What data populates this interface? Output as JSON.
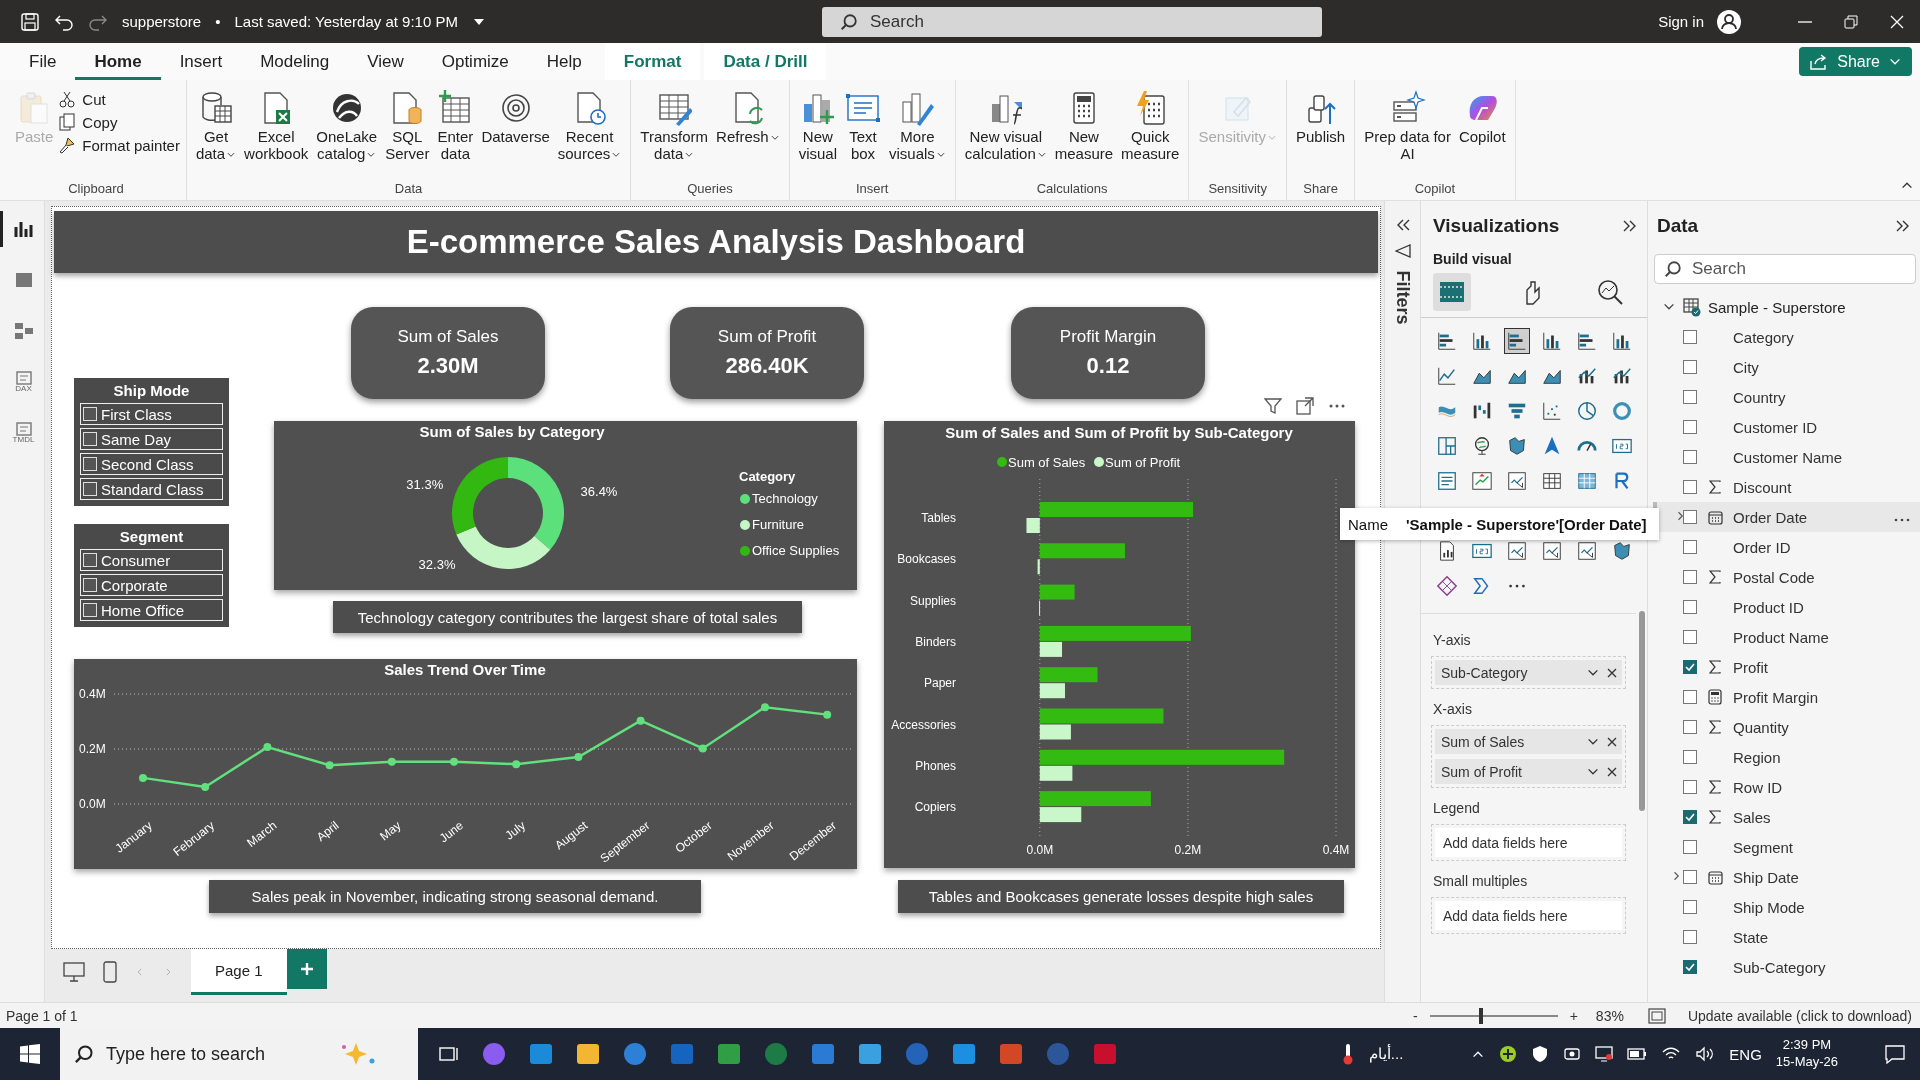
{
  "title_bar": {
    "file_name": "supperstore",
    "separator": "•",
    "saved": "Last saved: Yesterday at 9:10 PM",
    "search_placeholder": "Search",
    "sign_in": "Sign in"
  },
  "menu_tabs": [
    {
      "label": "File",
      "kind": "normal",
      "selected": false
    },
    {
      "label": "Home",
      "kind": "normal",
      "selected": true
    },
    {
      "label": "Insert",
      "kind": "normal",
      "selected": false
    },
    {
      "label": "Modeling",
      "kind": "normal",
      "selected": false
    },
    {
      "label": "View",
      "kind": "normal",
      "selected": false
    },
    {
      "label": "Optimize",
      "kind": "normal",
      "selected": false
    },
    {
      "label": "Help",
      "kind": "normal",
      "selected": false
    },
    {
      "label": "Format",
      "kind": "contextual",
      "selected": false
    },
    {
      "label": "Data / Drill",
      "kind": "contextual",
      "selected": false
    }
  ],
  "share_button": "Share",
  "ribbon": [
    {
      "group": "Clipboard",
      "buttons": [
        {
          "label": "Paste",
          "kind": "large",
          "disabled": true,
          "dropdown": false
        },
        {
          "label": "Cut",
          "kind": "small",
          "disabled": false,
          "dropdown": false
        },
        {
          "label": "Copy",
          "kind": "small",
          "disabled": false,
          "dropdown": false
        },
        {
          "label": "Format painter",
          "kind": "small",
          "disabled": false,
          "dropdown": false
        }
      ]
    },
    {
      "group": "Data",
      "buttons": [
        {
          "label": "Get\ndata",
          "kind": "large",
          "disabled": false,
          "dropdown": true
        },
        {
          "label": "Excel\nworkbook",
          "kind": "large",
          "disabled": false,
          "dropdown": false
        },
        {
          "label": "OneLake\ncatalog",
          "kind": "large",
          "disabled": false,
          "dropdown": true
        },
        {
          "label": "SQL\nServer",
          "kind": "large",
          "disabled": false,
          "dropdown": false
        },
        {
          "label": "Enter\ndata",
          "kind": "large",
          "disabled": false,
          "dropdown": false
        },
        {
          "label": "Dataverse",
          "kind": "large",
          "disabled": false,
          "dropdown": false
        },
        {
          "label": "Recent\nsources",
          "kind": "large",
          "disabled": false,
          "dropdown": true
        }
      ]
    },
    {
      "group": "Queries",
      "buttons": [
        {
          "label": "Transform\ndata",
          "kind": "large",
          "disabled": false,
          "dropdown": true
        },
        {
          "label": "Refresh",
          "kind": "large",
          "disabled": false,
          "dropdown": true
        }
      ]
    },
    {
      "group": "Insert",
      "buttons": [
        {
          "label": "New\nvisual",
          "kind": "large",
          "disabled": false,
          "dropdown": false
        },
        {
          "label": "Text\nbox",
          "kind": "large",
          "disabled": false,
          "dropdown": false
        },
        {
          "label": "More\nvisuals",
          "kind": "large",
          "disabled": false,
          "dropdown": true
        }
      ]
    },
    {
      "group": "Calculations",
      "buttons": [
        {
          "label": "New visual\ncalculation",
          "kind": "large",
          "disabled": false,
          "dropdown": true
        },
        {
          "label": "New\nmeasure",
          "kind": "large",
          "disabled": false,
          "dropdown": false
        },
        {
          "label": "Quick\nmeasure",
          "kind": "large",
          "disabled": false,
          "dropdown": false
        }
      ]
    },
    {
      "group": "Sensitivity",
      "buttons": [
        {
          "label": "Sensitivity",
          "kind": "large",
          "disabled": true,
          "dropdown": true
        }
      ]
    },
    {
      "group": "Share",
      "buttons": [
        {
          "label": "Publish",
          "kind": "large",
          "disabled": false,
          "dropdown": false
        }
      ]
    },
    {
      "group": "Copilot",
      "buttons": [
        {
          "label": "Prep data for\nAI",
          "kind": "large",
          "disabled": false,
          "dropdown": false
        },
        {
          "label": "Copilot",
          "kind": "large",
          "disabled": false,
          "dropdown": false
        }
      ]
    }
  ],
  "rail": [
    {
      "kind": "report",
      "selected": true
    },
    {
      "kind": "table",
      "selected": false
    },
    {
      "kind": "model",
      "selected": false
    },
    {
      "kind": "dax",
      "text": "DAX",
      "selected": false
    },
    {
      "kind": "tmdl",
      "text": "TMDL",
      "selected": false
    }
  ],
  "canvas": {
    "banner": "E-commerce Sales Analysis Dashboard",
    "cards": [
      {
        "label": "Sum of Sales",
        "value": "2.30M"
      },
      {
        "label": "Sum of Profit",
        "value": "286.40K"
      },
      {
        "label": "Profit Margin",
        "value": "0.12"
      }
    ],
    "slicers": [
      {
        "title": "Ship Mode",
        "items": [
          {
            "label": "First Class",
            "checked": false
          },
          {
            "label": "Same Day",
            "checked": false
          },
          {
            "label": "Second Class",
            "checked": false
          },
          {
            "label": "Standard Class",
            "checked": false
          }
        ]
      },
      {
        "title": "Segment",
        "items": [
          {
            "label": "Consumer",
            "checked": false
          },
          {
            "label": "Corporate",
            "checked": false
          },
          {
            "label": "Home Office",
            "checked": false
          }
        ]
      }
    ],
    "donut": {
      "legend_title": "Category",
      "legend": [
        {
          "color": "#5ce07c"
        },
        {
          "color": "#c6f5c6"
        },
        {
          "color": "#33b812"
        }
      ],
      "chart_data": {
        "type": "donut",
        "title": "Sum of Sales by Category",
        "categories": [
          "Technology",
          "Furniture",
          "Office Supplies"
        ],
        "series": [
          {
            "values": [
              36.4,
              32.3,
              31.3
            ]
          }
        ],
        "value_labels": [
          "36.4%",
          "32.3%",
          "31.3%"
        ],
        "legend": "right"
      }
    },
    "bar_chart": {
      "chart_data": {
        "type": "bar",
        "orientation": "horizontal",
        "title": "Sum of Sales and Sum of Profit by Sub-Category",
        "categories": [
          "Tables",
          "Bookcases",
          "Supplies",
          "Binders",
          "Paper",
          "Accessories",
          "Phones",
          "Copiers"
        ],
        "series": [
          {
            "name": "Sum of Sales",
            "color": "#33bb11",
            "values": [
              0.207,
              0.115,
              0.047,
              0.204,
              0.078,
              0.167,
              0.33,
              0.15
            ]
          },
          {
            "name": "Sum of Profit",
            "color": "#c9f7c9",
            "values": [
              -0.018,
              -0.003,
              -0.001,
              0.03,
              0.034,
              0.042,
              0.044,
              0.056
            ]
          }
        ],
        "xlim": [
          -0.02,
          0.4
        ],
        "xticks": [
          {
            "value": 0,
            "label": "0.0M"
          },
          {
            "value": 0.2,
            "label": "0.2M"
          },
          {
            "value": 0.4,
            "label": "0.4M"
          }
        ],
        "legend": "top"
      }
    },
    "line_chart": {
      "chart_data": {
        "type": "line",
        "title": "Sales Trend Over Time",
        "categories": [
          "January",
          "February",
          "March",
          "April",
          "May",
          "June",
          "July",
          "August",
          "September",
          "October",
          "November",
          "December"
        ],
        "series": [
          {
            "color": "#62e07e",
            "marker": "circle",
            "values": [
              0.095,
              0.062,
              0.207,
              0.141,
              0.154,
              0.154,
              0.145,
              0.171,
              0.303,
              0.202,
              0.352,
              0.325
            ]
          }
        ],
        "ylim": [
          0,
          0.4
        ],
        "yticks": [
          {
            "value": 0,
            "label": "0.0M"
          },
          {
            "value": 0.2,
            "label": "0.2M"
          },
          {
            "value": 0.4,
            "label": "0.4M"
          }
        ]
      }
    },
    "captions": [
      "Technology category contributes the largest share of total sales",
      "Sales peak in November, indicating strong seasonal demand.",
      "Tables and Bookcases generate losses despite high sales"
    ]
  },
  "filters_label": "Filters",
  "visualizations": {
    "title": "Visualizations",
    "subtitle": "Build visual",
    "tabs": [
      {
        "selected": true
      },
      {
        "selected": false
      },
      {
        "selected": false
      }
    ],
    "visual_types": [
      {
        "kind": "bar",
        "selected": false
      },
      {
        "kind": "column",
        "selected": false
      },
      {
        "kind": "bar",
        "selected": true
      },
      {
        "kind": "column",
        "selected": false
      },
      {
        "kind": "bar",
        "selected": false
      },
      {
        "kind": "column",
        "selected": false
      },
      {
        "kind": "line",
        "selected": false
      },
      {
        "kind": "area",
        "selected": false
      },
      {
        "kind": "area",
        "selected": false
      },
      {
        "kind": "area",
        "selected": false
      },
      {
        "kind": "combo",
        "selected": false
      },
      {
        "kind": "combo",
        "selected": false
      },
      {
        "kind": "ribbon",
        "selected": false
      },
      {
        "kind": "waterfall",
        "selected": false
      },
      {
        "kind": "funnel",
        "selected": false
      },
      {
        "kind": "scatter",
        "selected": false
      },
      {
        "kind": "pie",
        "selected": false
      },
      {
        "kind": "donut",
        "selected": false
      },
      {
        "kind": "treemap",
        "selected": false
      },
      {
        "kind": "globe",
        "selected": false
      },
      {
        "kind": "map",
        "selected": false
      },
      {
        "kind": "arrow",
        "selected": false
      },
      {
        "kind": "gauge",
        "selected": false
      },
      {
        "kind": "card",
        "selected": false
      },
      {
        "kind": "list",
        "selected": false
      },
      {
        "kind": "kpi",
        "selected": false
      },
      {
        "kind": "slicer",
        "selected": false
      },
      {
        "kind": "table",
        "selected": false
      },
      {
        "kind": "matrix",
        "selected": false
      },
      {
        "kind": "script",
        "selected": false
      },
      {
        "kind": "report",
        "selected": false
      },
      {
        "kind": "card",
        "selected": false
      },
      {
        "kind": "slicer",
        "selected": false
      },
      {
        "kind": "slicer",
        "selected": false
      },
      {
        "kind": "slicer",
        "selected": false
      },
      {
        "kind": "map",
        "selected": false
      },
      {
        "kind": "diamond",
        "selected": false
      },
      {
        "kind": "chevrons",
        "selected": false
      },
      {
        "kind": "more",
        "selected": false
      }
    ],
    "wells": [
      {
        "label": "Y-axis",
        "fields": [
          "Sub-Category"
        ]
      },
      {
        "label": "X-axis",
        "fields": [
          "Sum of Sales",
          "Sum of Profit"
        ]
      },
      {
        "label": "Legend",
        "placeholder": "Add data fields here"
      },
      {
        "label": "Small multiples",
        "placeholder": "Add data fields here"
      }
    ]
  },
  "tooltip": {
    "label": "Name",
    "value": "'Sample - Superstore'[Order Date]"
  },
  "data_pane": {
    "title": "Data",
    "search_placeholder": "Search",
    "table": {
      "name": "Sample - Superstore",
      "expanded": true,
      "fields": [
        {
          "name": "Category",
          "kind": "plain",
          "checked": false,
          "hovered": false
        },
        {
          "name": "City",
          "kind": "plain",
          "checked": false,
          "hovered": false
        },
        {
          "name": "Country",
          "kind": "plain",
          "checked": false,
          "hovered": false
        },
        {
          "name": "Customer ID",
          "kind": "plain",
          "checked": false,
          "hovered": false
        },
        {
          "name": "Customer Name",
          "kind": "plain",
          "checked": false,
          "hovered": false
        },
        {
          "name": "Discount",
          "kind": "sum",
          "checked": false,
          "hovered": false
        },
        {
          "name": "Order Date",
          "kind": "date",
          "checked": false,
          "hovered": true
        },
        {
          "name": "Order ID",
          "kind": "plain",
          "checked": false,
          "hovered": false
        },
        {
          "name": "Postal Code",
          "kind": "sum",
          "checked": false,
          "hovered": false
        },
        {
          "name": "Product ID",
          "kind": "plain",
          "checked": false,
          "hovered": false
        },
        {
          "name": "Product Name",
          "kind": "plain",
          "checked": false,
          "hovered": false
        },
        {
          "name": "Profit",
          "kind": "sum",
          "checked": true,
          "hovered": false
        },
        {
          "name": "Profit Margin",
          "kind": "measure",
          "checked": false,
          "hovered": false
        },
        {
          "name": "Quantity",
          "kind": "sum",
          "checked": false,
          "hovered": false
        },
        {
          "name": "Region",
          "kind": "plain",
          "checked": false,
          "hovered": false
        },
        {
          "name": "Row ID",
          "kind": "sum",
          "checked": false,
          "hovered": false
        },
        {
          "name": "Sales",
          "kind": "sum",
          "checked": true,
          "hovered": false
        },
        {
          "name": "Segment",
          "kind": "plain",
          "checked": false,
          "hovered": false
        },
        {
          "name": "Ship Date",
          "kind": "date",
          "checked": false,
          "hovered": false
        },
        {
          "name": "Ship Mode",
          "kind": "plain",
          "checked": false,
          "hovered": false
        },
        {
          "name": "State",
          "kind": "plain",
          "checked": false,
          "hovered": false
        },
        {
          "name": "Sub-Category",
          "kind": "plain",
          "checked": true,
          "hovered": false
        }
      ]
    }
  },
  "page_tabs": [
    {
      "label": "Page 1",
      "selected": true
    }
  ],
  "status_bar": {
    "page": "Page 1 of 1",
    "zoom_out": "-",
    "zoom_in": "+",
    "zoom": {
      "level": 0.4
    },
    "zoom_reading": "83%",
    "update": "Update available (click to download)"
  },
  "taskbar": {
    "search_placeholder": "Type here to search",
    "weather": "أيام...",
    "language": "ENG",
    "time": "2:39 PM",
    "date": "15-May-26"
  }
}
